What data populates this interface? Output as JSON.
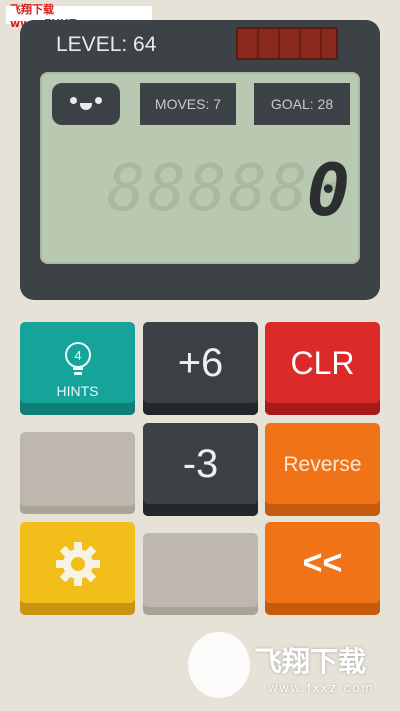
{
  "watermark_top": "飞翔下载 www.FXXZ.com",
  "level_label": "LEVEL: 64",
  "moves_label": "MOVES: 7",
  "goal_label": "GOAL: 28",
  "display": {
    "ghost": "888888",
    "value": "0"
  },
  "buttons": {
    "hints": {
      "count": "4",
      "label": "HINTS"
    },
    "plus6": "+6",
    "clr": "CLR",
    "minus3": "-3",
    "reverse": "Reverse",
    "back": "<<"
  },
  "icons": {
    "hint": "lightbulb-icon",
    "settings": "gear-icon",
    "face": "smiley-face-icon"
  },
  "watermark_bottom": {
    "title": "飞翔下载",
    "url": "www.fxxz.com"
  },
  "colors": {
    "device": "#3d4246",
    "screen": "#b9c8b0",
    "teal": "#16a39a",
    "red": "#db2a2a",
    "orange": "#f07318",
    "yellow": "#f1be1a",
    "gray_blank": "#bdb7ad"
  }
}
